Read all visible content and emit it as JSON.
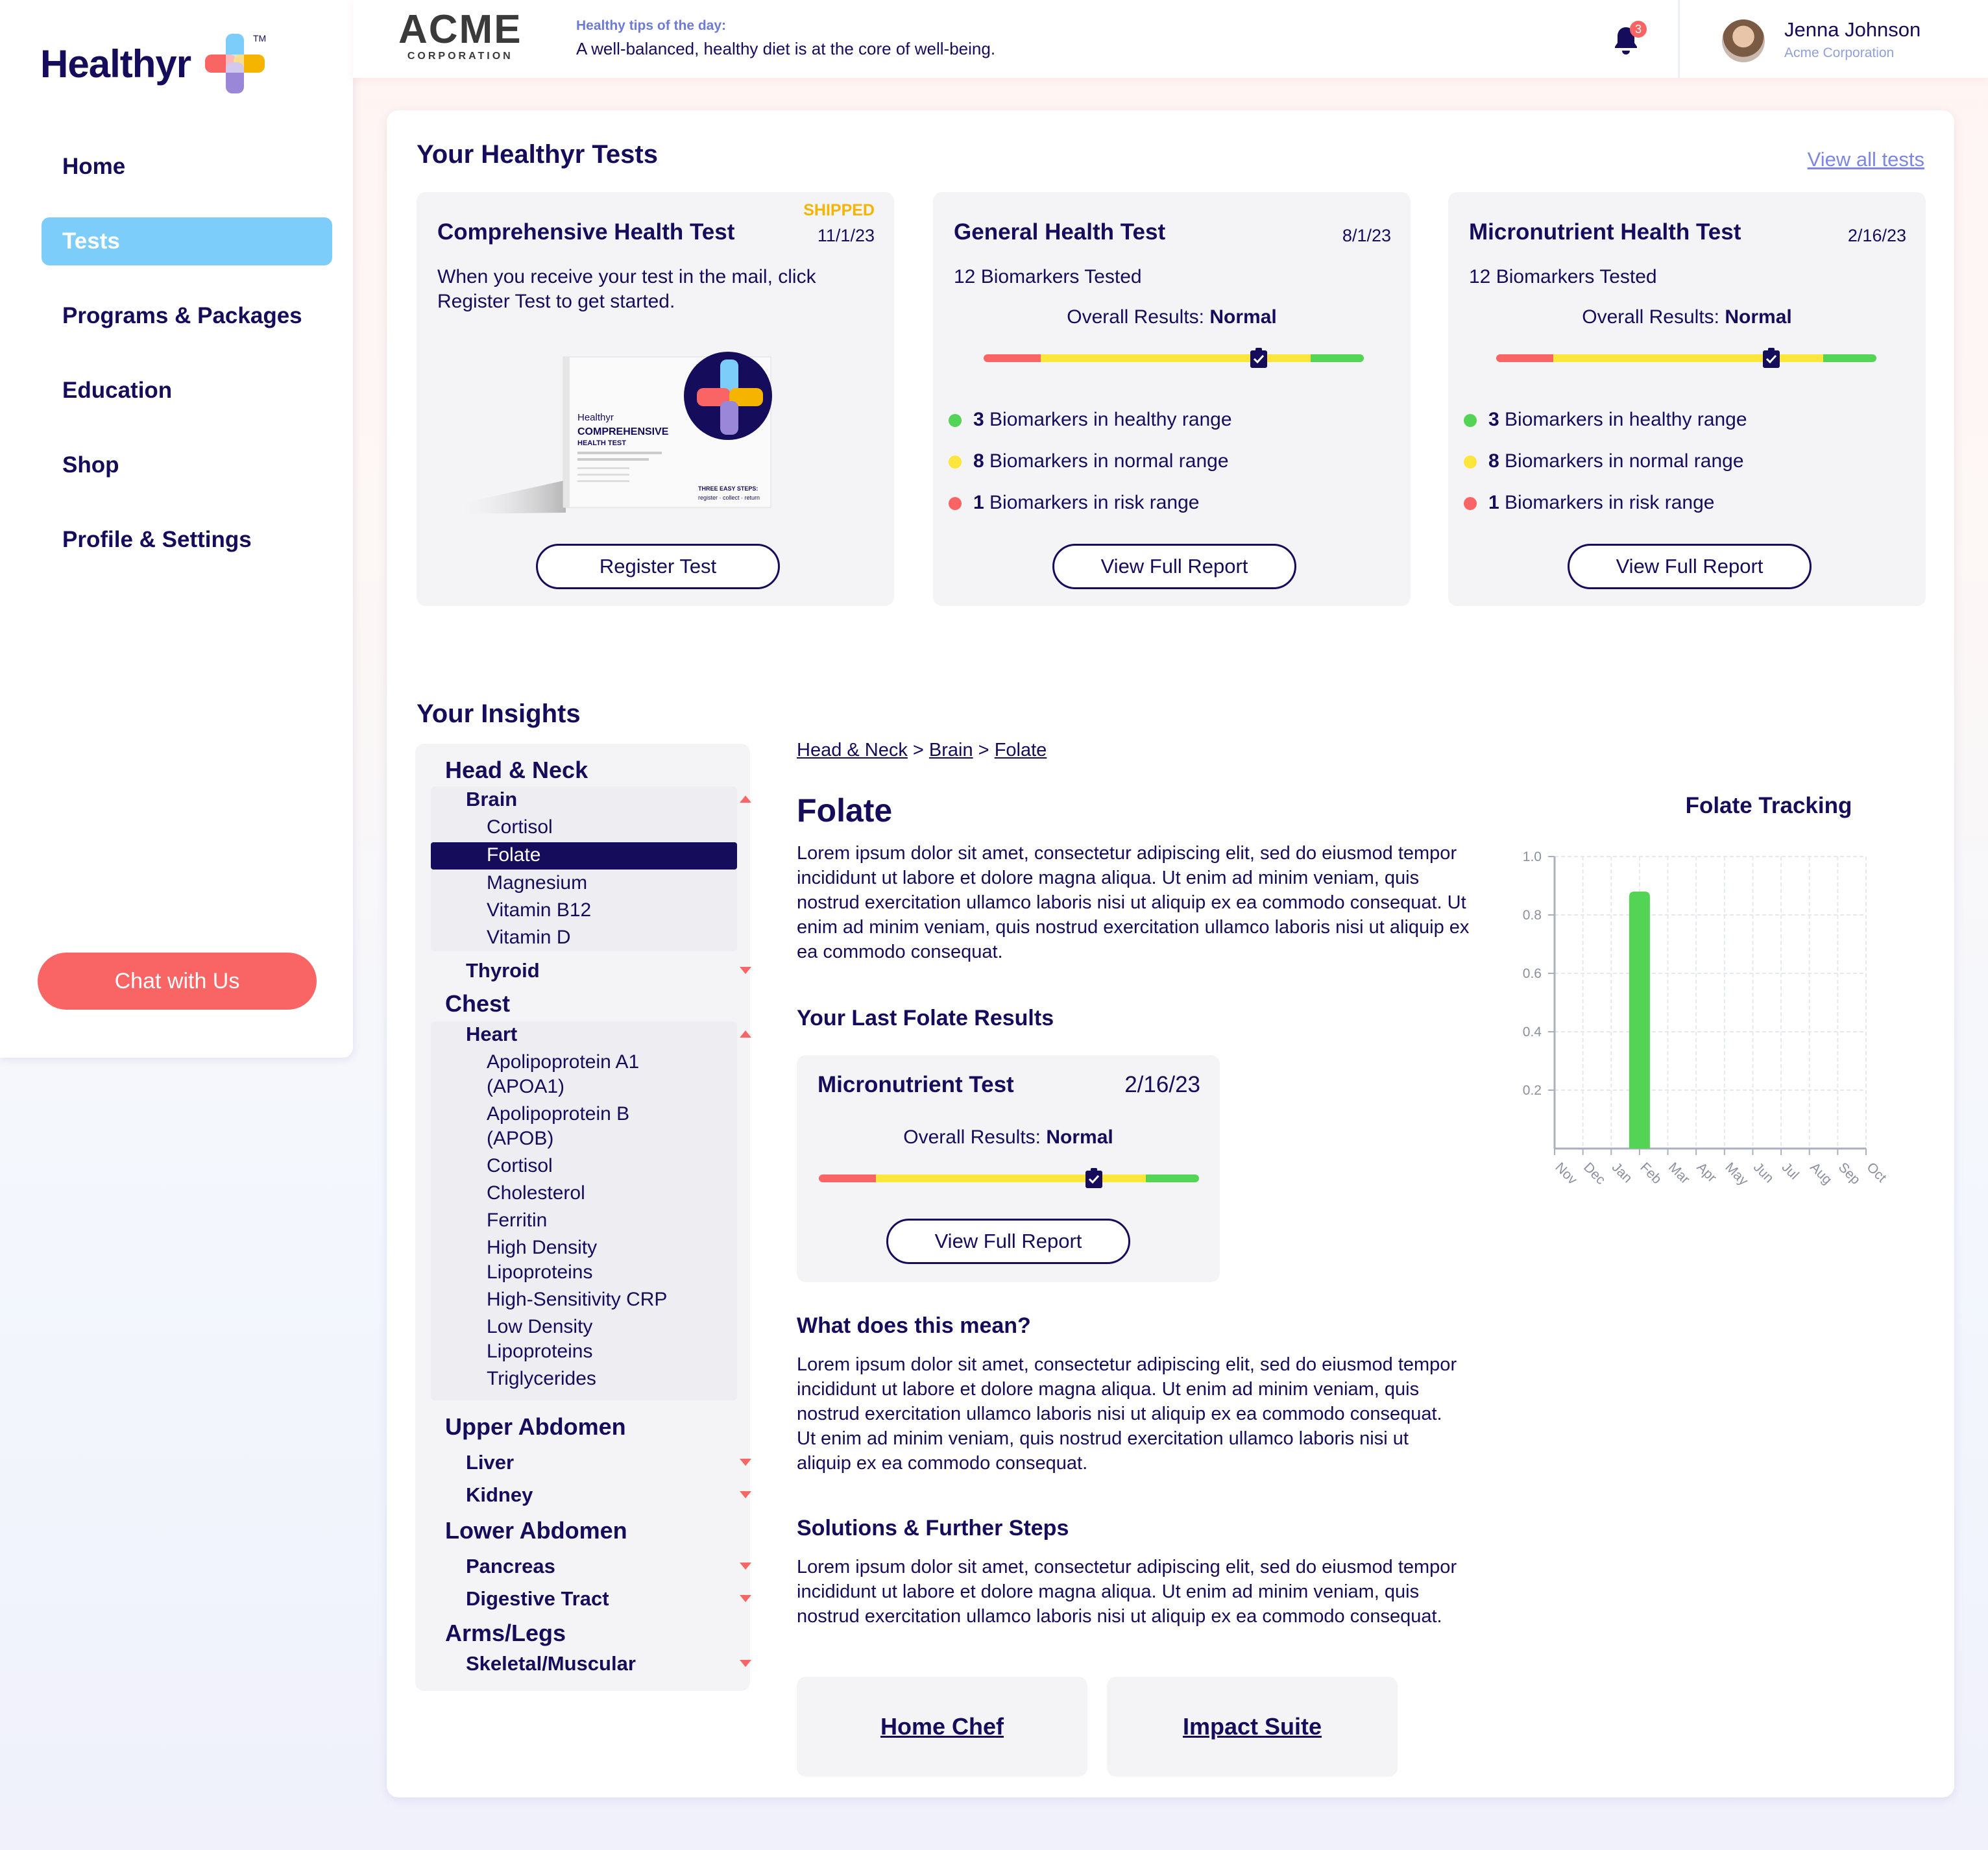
{
  "brand": {
    "name": "Healthyr",
    "tm": "TM"
  },
  "nav": {
    "items": [
      "Home",
      "Tests",
      "Programs & Packages",
      "Education",
      "Shop",
      "Profile & Settings"
    ],
    "active": "Tests",
    "chat_label": "Chat with Us"
  },
  "header": {
    "company": {
      "name": "ACME",
      "sub": "CORPORATION"
    },
    "tip_label": "Healthy tips of the day:",
    "tip_text": "A well-balanced, healthy diet is at the core of well-being.",
    "notifications": "3",
    "user": {
      "name": "Jenna Johnson",
      "org": "Acme Corporation"
    }
  },
  "tests": {
    "title": "Your Healthyr Tests",
    "view_all": "View all tests",
    "cards": [
      {
        "title": "Comprehensive Health Test",
        "status": "SHIPPED",
        "date": "11/1/23",
        "text": "When you receive your test in the mail, click Register Test to get started.",
        "button": "Register Test",
        "kit": {
          "brand": "Healthyr",
          "line1": "COMPREHENSIVE",
          "line2": "HEALTH TEST",
          "steps": "THREE EASY STEPS:",
          "step_words": "register · collect · return"
        }
      },
      {
        "title": "General Health Test",
        "date": "8/1/23",
        "count": "12 Biomarkers Tested",
        "overall_label": "Overall Results:",
        "overall_value": "Normal",
        "healthy_n": "3",
        "healthy": "Biomarkers in healthy range",
        "normal_n": "8",
        "normal": "Biomarkers in normal range",
        "risk_n": "1",
        "risk": "Biomarkers in risk range",
        "button": "View Full Report"
      },
      {
        "title": "Micronutrient Health Test",
        "date": "2/16/23",
        "count": "12 Biomarkers Tested",
        "overall_label": "Overall Results:",
        "overall_value": "Normal",
        "healthy_n": "3",
        "healthy": "Biomarkers in healthy range",
        "normal_n": "8",
        "normal": "Biomarkers in normal range",
        "risk_n": "1",
        "risk": "Biomarkers in risk range",
        "button": "View Full Report"
      }
    ],
    "range_colors": {
      "risk": "#f96464",
      "normal": "#fde63b",
      "healthy": "#53d454"
    }
  },
  "insights": {
    "title": "Your Insights",
    "tree": {
      "head_neck": "Head & Neck",
      "brain": "Brain",
      "brain_items": [
        "Cortisol",
        "Folate",
        "Magnesium",
        "Vitamin B12",
        "Vitamin D"
      ],
      "thyroid": "Thyroid",
      "chest": "Chest",
      "heart": "Heart",
      "heart_items": [
        "Apolipoprotein A1",
        "(APOA1)",
        "Apolipoprotein B",
        "(APOB)",
        "Cortisol",
        "Cholesterol",
        "Ferritin",
        "High Density",
        "Lipoproteins",
        "High-Sensitivity CRP",
        "Low Density",
        "Lipoproteins",
        "Triglycerides"
      ],
      "upper": "Upper Abdomen",
      "liver": "Liver",
      "kidney": "Kidney",
      "lower": "Lower Abdomen",
      "pancreas": "Pancreas",
      "digestive": "Digestive Tract",
      "arms": "Arms/Legs",
      "skeletal": "Skeletal/Muscular"
    },
    "breadcrumb": [
      "Head & Neck",
      "Brain",
      "Folate"
    ],
    "heading": "Folate",
    "intro": "Lorem ipsum dolor sit amet, consectetur adipiscing elit, sed do eiusmod tempor incididunt ut labore et dolore magna aliqua. Ut enim ad minim veniam, quis nostrud exercitation ullamco laboris nisi ut aliquip ex ea commodo consequat. Ut enim ad minim veniam, quis nostrud exercitation ullamco laboris nisi ut aliquip ex ea commodo consequat.",
    "last_results_title": "Your Last Folate Results",
    "last_card": {
      "title": "Micronutrient Test",
      "date": "2/16/23",
      "overall_label": "Overall Results:",
      "overall_value": "Normal",
      "button": "View Full Report"
    },
    "meaning_title": "What does this mean?",
    "meaning": "Lorem ipsum dolor sit amet, consectetur adipiscing elit, sed do eiusmod tempor incididunt ut labore et dolore magna aliqua. Ut enim ad minim veniam, quis nostrud exercitation ullamco laboris nisi ut aliquip ex ea commodo consequat. Ut enim ad minim veniam, quis nostrud exercitation ullamco laboris nisi ut aliquip ex ea commodo consequat.",
    "solutions_title": "Solutions & Further Steps",
    "solutions": "Lorem ipsum dolor sit amet, consectetur adipiscing elit, sed do eiusmod tempor incididunt ut labore et dolore magna aliqua. Ut enim ad minim veniam, quis nostrud exercitation ullamco laboris nisi ut aliquip ex ea commodo consequat.",
    "links": [
      "Home Chef",
      "Impact Suite"
    ]
  },
  "chart_data": {
    "type": "bar",
    "title": "Folate Tracking",
    "categories": [
      "Nov",
      "Dec",
      "Jan",
      "Feb",
      "Mar",
      "Apr",
      "May",
      "Jun",
      "Jul",
      "Aug",
      "Sep",
      "Oct"
    ],
    "values": [
      null,
      null,
      null,
      0.88,
      null,
      null,
      null,
      null,
      null,
      null,
      null,
      null
    ],
    "ylim": [
      0,
      1.0
    ],
    "yticks": [
      0.2,
      0.4,
      0.6,
      0.8,
      1.0
    ],
    "grid": true,
    "bar_color": "#53d454"
  }
}
